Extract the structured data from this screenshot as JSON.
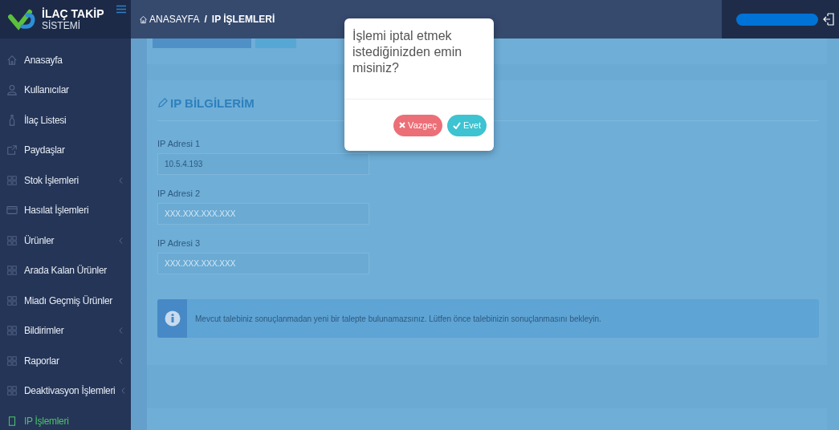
{
  "brand": {
    "title": "İLAÇ TAKİP",
    "subtitle": "SİSTEMİ"
  },
  "header": {
    "breadcrumb": [
      {
        "label": "ANASAYFA"
      },
      {
        "label": "IP İŞLEMLERİ"
      }
    ],
    "separator": "/"
  },
  "sidebar": {
    "items": [
      {
        "label": "Anasayfa",
        "kind": "home",
        "submenu": false,
        "selected": false
      },
      {
        "label": "Kullanıcılar",
        "kind": "user",
        "submenu": false,
        "selected": false
      },
      {
        "label": "İlaç Listesi",
        "kind": "bottle",
        "submenu": false,
        "selected": false
      },
      {
        "label": "Paydaşlar",
        "kind": "share",
        "submenu": false,
        "selected": false
      },
      {
        "label": "Stok İşlemleri",
        "kind": "grid",
        "submenu": true,
        "selected": false
      },
      {
        "label": "Hasılat İşlemleri",
        "kind": "card",
        "submenu": false,
        "selected": false
      },
      {
        "label": "Ürünler",
        "kind": "grid",
        "submenu": true,
        "selected": false
      },
      {
        "label": "Arada Kalan Ürünler",
        "kind": "grid",
        "submenu": false,
        "selected": false
      },
      {
        "label": "Miadı Geçmiş Ürünler",
        "kind": "grid",
        "submenu": false,
        "selected": false
      },
      {
        "label": "Bildirimler",
        "kind": "grid",
        "submenu": true,
        "selected": false
      },
      {
        "label": "Raporlar",
        "kind": "grid",
        "submenu": true,
        "selected": false
      },
      {
        "label": "Deaktivasyon İşlemleri",
        "kind": "grid",
        "submenu": true,
        "selected": false
      },
      {
        "label": "IP İşlemleri",
        "kind": "square",
        "submenu": false,
        "selected": true
      }
    ]
  },
  "top_buttons": [
    {
      "kind": "primary"
    },
    {
      "kind": "info"
    }
  ],
  "form": {
    "title": "IP BİLGİLERİM",
    "fields": [
      {
        "label": "IP Adresi 1",
        "value": "10.5.4.193"
      },
      {
        "label": "IP Adresi 2",
        "placeholder": "XXX.XXX.XXX.XXX"
      },
      {
        "label": "IP Adresi 3",
        "placeholder": "XXX.XXX.XXX.XXX"
      }
    ],
    "alert": "Mevcut talebiniz sonuçlanmadan yeni bir talepte bulunamazsınız. Lütfen önce talebinizin sonuçlanmasını bekleyin."
  },
  "dialog": {
    "message": "İşlemi iptal etmek istediğinizden emin misiniz?",
    "buttons": [
      {
        "label": "Vazgeç",
        "kind": "cancel"
      },
      {
        "label": "Evet",
        "kind": "confirm"
      }
    ]
  }
}
